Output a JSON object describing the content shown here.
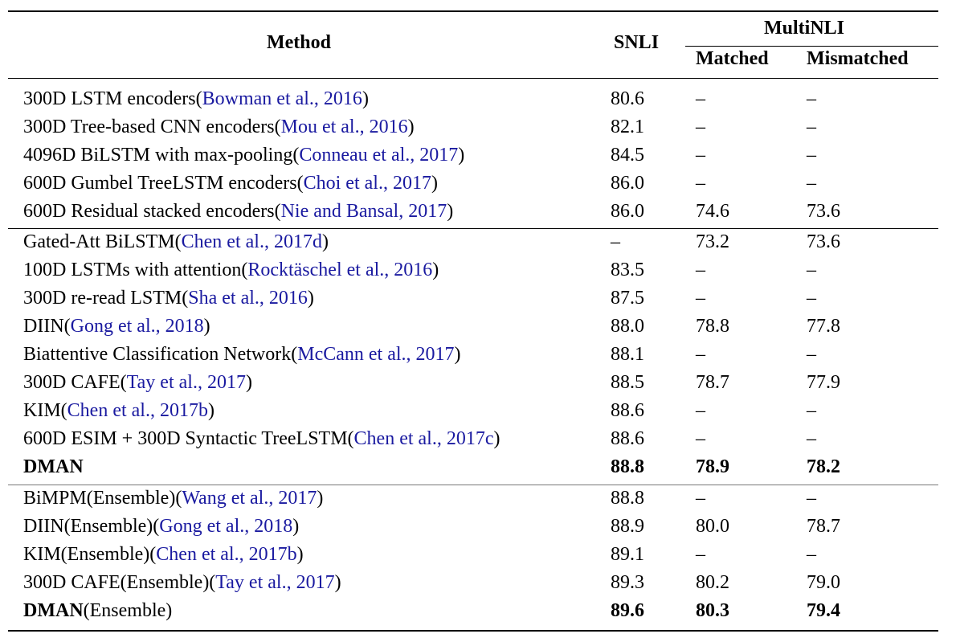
{
  "header": {
    "method": "Method",
    "snli": "SNLI",
    "multinli": "MultiNLI",
    "matched": "Matched",
    "mismatched": "Mismatched"
  },
  "rows": [
    {
      "name": "300D LSTM encoders(",
      "cite": "Bowman et al., 2016",
      "close": ")",
      "snli": "80.6",
      "matched": "–",
      "mismatched": "–"
    },
    {
      "name": "300D Tree-based CNN encoders(",
      "cite": "Mou et al., 2016",
      "close": ")",
      "snli": "82.1",
      "matched": "–",
      "mismatched": "–"
    },
    {
      "name": "4096D BiLSTM with max-pooling(",
      "cite": "Conneau et al., 2017",
      "close": ")",
      "snli": "84.5",
      "matched": "–",
      "mismatched": "–"
    },
    {
      "name": "600D Gumbel TreeLSTM encoders(",
      "cite": "Choi et al., 2017",
      "close": ")",
      "snli": "86.0",
      "matched": "–",
      "mismatched": "–"
    },
    {
      "name": "600D Residual stacked encoders(",
      "cite": "Nie and Bansal, 2017",
      "close": ")",
      "snli": "86.0",
      "matched": "74.6",
      "mismatched": "73.6"
    },
    {
      "name": "Gated-Att BiLSTM(",
      "cite": "Chen et al., 2017d",
      "close": ")",
      "snli": "–",
      "matched": "73.2",
      "mismatched": "73.6"
    },
    {
      "name": "100D LSTMs with attention(",
      "cite": "Rocktäschel et al., 2016",
      "close": ")",
      "snli": "83.5",
      "matched": "–",
      "mismatched": "–"
    },
    {
      "name": "300D re-read LSTM(",
      "cite": "Sha et al., 2016",
      "close": ")",
      "snli": "87.5",
      "matched": "–",
      "mismatched": "–"
    },
    {
      "name": "DIIN(",
      "cite": "Gong et al., 2018",
      "close": ")",
      "snli": "88.0",
      "matched": "78.8",
      "mismatched": "77.8"
    },
    {
      "name": "Biattentive Classification Network(",
      "cite": "McCann et al., 2017",
      "close": ")",
      "snli": "88.1",
      "matched": "–",
      "mismatched": "–"
    },
    {
      "name": "300D CAFE(",
      "cite": "Tay et al., 2017",
      "close": ")",
      "snli": "88.5",
      "matched": "78.7",
      "mismatched": "77.9"
    },
    {
      "name": "KIM(",
      "cite": "Chen et al., 2017b",
      "close": ")",
      "snli": "88.6",
      "matched": "–",
      "mismatched": "–"
    },
    {
      "name": "600D ESIM + 300D Syntactic TreeLSTM(",
      "cite": "Chen et al., 2017c",
      "close": ")",
      "snli": "88.6",
      "matched": "–",
      "mismatched": "–"
    },
    {
      "bold": "DMAN",
      "name": "",
      "cite": "",
      "close": "",
      "snli": "88.8",
      "matched": "78.9",
      "mismatched": "78.2"
    },
    {
      "name": "BiMPM(Ensemble)(",
      "cite": "Wang et al., 2017",
      "close": ")",
      "snli": "88.8",
      "matched": "–",
      "mismatched": "–"
    },
    {
      "name": "DIIN(Ensemble)(",
      "cite": "Gong et al., 2018",
      "close": ")",
      "snli": "88.9",
      "matched": "80.0",
      "mismatched": "78.7"
    },
    {
      "name": "KIM(Ensemble)(",
      "cite": "Chen et al., 2017b",
      "close": ")",
      "snli": "89.1",
      "matched": "–",
      "mismatched": "–"
    },
    {
      "name": "300D CAFE(Ensemble)(",
      "cite": "Tay et al., 2017",
      "close": ")",
      "snli": "89.3",
      "matched": "80.2",
      "mismatched": "79.0"
    },
    {
      "bold": "DMAN",
      "name": "(Ensemble)",
      "cite": "",
      "close": "",
      "snli": "89.6",
      "matched": "80.3",
      "mismatched": "79.4"
    }
  ],
  "colors": {
    "citation": "#1a1aa0",
    "text": "#000000"
  }
}
